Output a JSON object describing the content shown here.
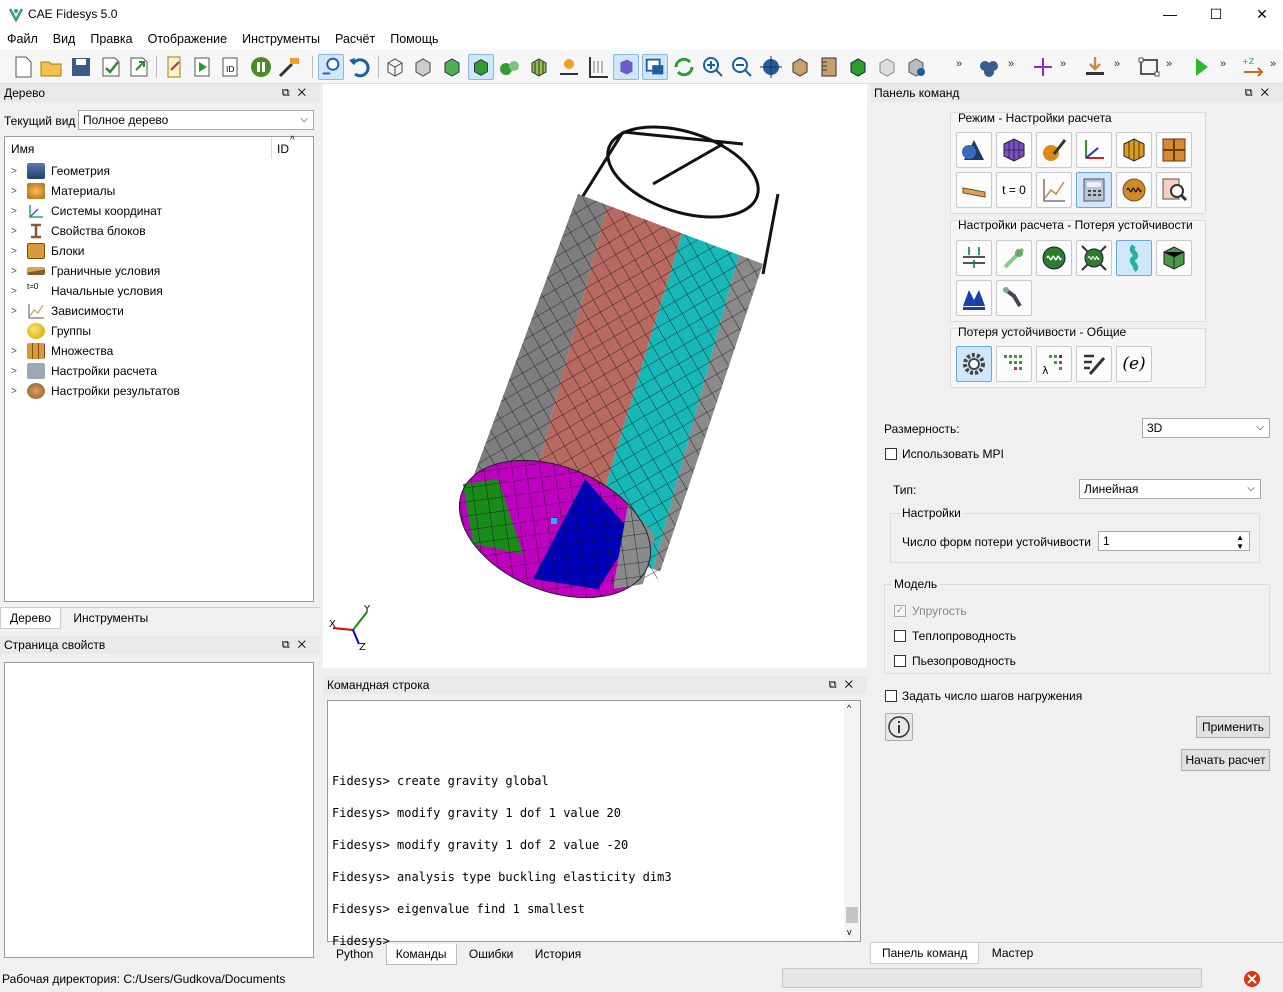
{
  "window": {
    "title": "CAE Fidesys 5.0"
  },
  "menu": [
    "Файл",
    "Вид",
    "Правка",
    "Отображение",
    "Инструменты",
    "Расчёт",
    "Помощь"
  ],
  "tree_panel": {
    "title": "Дерево",
    "current_view_label": "Текущий вид",
    "current_view_value": "Полное дерево",
    "col_name": "Имя",
    "col_id": "ID",
    "items": [
      "Геометрия",
      "Материалы",
      "Системы координат",
      "Свойства блоков",
      "Блоки",
      "Граничные условия",
      "Начальные условия",
      "Зависимости",
      "Группы",
      "Множества",
      "Настройки расчета",
      "Настройки результатов"
    ],
    "tabs": [
      "Дерево",
      "Инструменты"
    ]
  },
  "properties_panel": {
    "title": "Страница свойств"
  },
  "viewport": {
    "axis_x": "X",
    "axis_y": "Y",
    "axis_z": "Z"
  },
  "command_line": {
    "title": "Командная строка",
    "lines": [
      "Fidesys> create gravity global",
      "Fidesys> modify gravity 1 dof 1 value 20",
      "Fidesys> modify gravity 1 dof 2 value -20",
      "Fidesys> analysis type buckling elasticity dim3",
      "Fidesys> eigenvalue find 1 smallest",
      "Fidesys>"
    ],
    "tabs": [
      "Python",
      "Команды",
      "Ошибки",
      "История"
    ]
  },
  "command_panel": {
    "title": "Панель команд",
    "group1_title": "Режим - Настройки расчета",
    "group2_title": "Настройки расчета - Потеря устойчивости",
    "group3_title": "Потеря устойчивости - Общие",
    "t0_label": "t = 0",
    "e_label": "(e)",
    "dimension_label": "Размерность:",
    "dimension_value": "3D",
    "use_mpi_label": "Использовать MPI",
    "type_label": "Тип:",
    "type_value": "Линейная",
    "settings_title": "Настройки",
    "modes_label": "Число форм потери устойчивости",
    "modes_value": "1",
    "model_title": "Модель",
    "elasticity_label": "Упругость",
    "thermal_label": "Теплопроводность",
    "piezo_label": "Пьезопроводность",
    "load_steps_label": "Задать число шагов нагружения",
    "apply_button": "Применить",
    "start_button": "Начать расчет",
    "tabs": [
      "Панель команд",
      "Мастер"
    ]
  },
  "status": {
    "workdir": "Рабочая директория: C:/Users/Gudkova/Documents"
  }
}
